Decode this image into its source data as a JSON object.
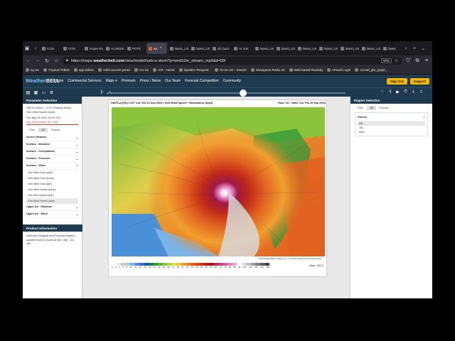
{
  "tabs": [
    {
      "label": "COD",
      "active": false
    },
    {
      "label": "COD",
      "active": false
    },
    {
      "label": "Super-En",
      "active": false
    },
    {
      "label": "AL092024",
      "active": false
    },
    {
      "label": "POTE",
      "active": false
    },
    {
      "label": "wx",
      "active": true
    },
    {
      "label": "latest_US",
      "active": false
    },
    {
      "label": "latest_US",
      "active": false
    },
    {
      "label": "all_hazz",
      "active": false
    },
    {
      "label": "AI Vort",
      "active": false
    },
    {
      "label": "latest_US",
      "active": false
    },
    {
      "label": "latest_US",
      "active": false
    },
    {
      "label": "latest_US",
      "active": false
    },
    {
      "label": "latest_US",
      "active": false
    },
    {
      "label": "latest_US",
      "active": false
    },
    {
      "label": "latest_US",
      "active": false
    },
    {
      "label": "latest",
      "active": false
    }
  ],
  "url": {
    "prefix": "https://maps.",
    "domain": "weatherbell.com",
    "path": "/view/model/hafs-a-storm?p=wnd10m_stream_mph&d=09l",
    "zoom": "80%"
  },
  "bookmarks": [
    "sg-wx",
    "Tropical Tidbits",
    "app admin",
    "AWS access portal",
    "CU-wx",
    "AIS - Home",
    "Speaker Request -",
    "To-do List - Smarts",
    "Shadgrass Radio Int",
    "Web-based Reanaly",
    "cPanel Login",
    "ecmwf_gfs_graph_"
  ],
  "site": {
    "logo_a": "Weather",
    "logo_b": "BELL",
    "nav": [
      "Home",
      "Commercial Services",
      "Maps ▾",
      "Premium",
      "Press / News",
      "Our Team",
      "Forecast Competition",
      "Community"
    ],
    "sign_out": "Sign Out",
    "support": "Support"
  },
  "left": {
    "header": "Parameter Selection",
    "model": "HAFS-a Storm - 0.02° Floating Sector",
    "param": "10m Wind Speed (mph)",
    "init": "Thu Sep 26 2024 12:00 UTC",
    "valid": "00Z 09/24 (Hour: 60 / 126)",
    "pills": [
      "Filter",
      "All",
      "Popular"
    ],
    "sections": [
      {
        "label": "Severe Weather",
        "open": false
      },
      {
        "label": "Surface - Moisture",
        "open": false
      },
      {
        "label": "Surface - Precipitation",
        "open": false
      },
      {
        "label": "Surface - Pressure",
        "open": false
      },
      {
        "label": "Surface - Wind",
        "open": true
      }
    ],
    "wind_items": [
      "10m Wind Gust (mph)",
      "10m Wind Gust (knots)",
      "10m Wind Gust (kph)",
      "10m Wind Speed (knots)",
      "10m Wind Speed (kph)",
      "10m Wind Speed (mph)"
    ],
    "more_sections": [
      "Upper Air - Moisture",
      "Upper Air - Wind"
    ],
    "product_header": "Product Information",
    "product_text": "Hurricane Analysis and Forecast System, updated every 6 hours at 00Z, 06Z, 12Z, 18Z"
  },
  "right": {
    "header": "Region Selection",
    "pills": [
      "Filter",
      "All",
      "Popular"
    ],
    "storms_label": "Storms",
    "storms": [
      "09L",
      "10L",
      "94W"
    ]
  },
  "map": {
    "title": "HAFS-A [09L] 0.02° Init: 00z 24 Sep 2024 | 10m Wind Speed + Streamlines [mph]",
    "hour": "Hour: 60 • Valid: 21z Thu 26 Sep 2024",
    "max": "Max: 142.2",
    "copyright": "© 2024 WeatherBELL Analytics LLC · Hurricane Analysis and Forecast System",
    "colorbar_labels": [
      "0",
      "2",
      "4",
      "6",
      "8",
      "10",
      "12",
      "14",
      "16",
      "18",
      "20",
      "22",
      "25",
      "28",
      "31",
      "34",
      "37",
      "40",
      "44",
      "48",
      "52",
      "56",
      "60",
      "65",
      "70",
      "75",
      "80",
      "85",
      "90",
      "100",
      "110",
      "120",
      "140",
      "160"
    ],
    "colors": [
      "#ffffff",
      "#e8e8e8",
      "#c8c8c8",
      "#a8c8e8",
      "#7db4e6",
      "#4a90d9",
      "#3a70c0",
      "#2a50a0",
      "#1e7a5a",
      "#2e9a3a",
      "#56b23a",
      "#8bc43a",
      "#b8d43a",
      "#e0e04a",
      "#f0c040",
      "#f0a030",
      "#e88028",
      "#e06020",
      "#d84418",
      "#c83010",
      "#b82010",
      "#a01818",
      "#b03060",
      "#c04080",
      "#d060a0",
      "#e080c0",
      "#f0a0d8",
      "#ffffff",
      "#e0e0e0",
      "#c0c0c0",
      "#a0a0a0",
      "#808080",
      "#606060",
      "#404040"
    ]
  }
}
